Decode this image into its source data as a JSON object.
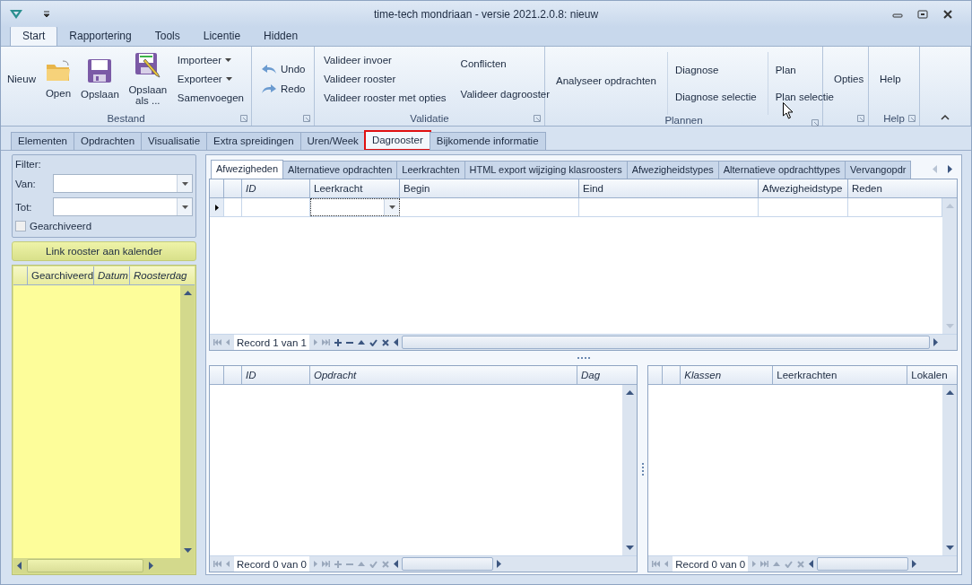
{
  "window": {
    "title": "time-tech mondriaan - versie 2021.2.0.8: nieuw"
  },
  "ribbon_tabs": [
    {
      "label": "Start",
      "selected": true
    },
    {
      "label": "Rapportering",
      "selected": false
    },
    {
      "label": "Tools",
      "selected": false
    },
    {
      "label": "Licentie",
      "selected": false
    },
    {
      "label": "Hidden",
      "selected": false
    }
  ],
  "ribbon": {
    "bestand": {
      "caption": "Bestand",
      "new": "Nieuw",
      "open": "Open",
      "save": "Opslaan",
      "save_as": "Opslaan als ...",
      "menu": [
        {
          "label": "Importeer",
          "dropdown": true
        },
        {
          "label": "Exporteer",
          "dropdown": true
        },
        {
          "label": "Samenvoegen",
          "dropdown": false
        }
      ]
    },
    "history": {
      "undo": "Undo",
      "redo": "Redo"
    },
    "validatie": {
      "caption": "Validatie",
      "column_1": [
        "Valideer invoer",
        "Valideer rooster",
        "Valideer rooster met opties"
      ],
      "column_2": [
        "Conflicten",
        "Valideer dagrooster"
      ]
    },
    "plannen": {
      "caption": "Plannen",
      "analyse": "Analyseer opdrachten",
      "column_1": [
        "Diagnose",
        "Diagnose selectie"
      ],
      "column_2": [
        "Plan",
        "Plan selectie"
      ]
    },
    "opties": {
      "label": "Opties"
    },
    "help": {
      "caption": "Help",
      "label": "Help"
    }
  },
  "main_tabs": [
    {
      "label": "Elementen",
      "selected": false,
      "highlighted": false
    },
    {
      "label": "Opdrachten",
      "selected": false,
      "highlighted": false
    },
    {
      "label": "Visualisatie",
      "selected": false,
      "highlighted": false
    },
    {
      "label": "Extra spreidingen",
      "selected": false,
      "highlighted": false
    },
    {
      "label": "Uren/Week",
      "selected": false,
      "highlighted": false
    },
    {
      "label": "Dagrooster",
      "selected": true,
      "highlighted": true
    },
    {
      "label": "Bijkomende informatie",
      "selected": false,
      "highlighted": false
    }
  ],
  "filter": {
    "title": "Filter:",
    "fields": [
      {
        "label": "Van:"
      },
      {
        "label": "Tot:"
      }
    ],
    "archived": {
      "label": "Gearchiveerd",
      "checked": false
    }
  },
  "link_button": "Link rooster aan kalender",
  "left_grid": {
    "columns": [
      {
        "label": "Gearchiveerd",
        "italic": false
      },
      {
        "label": "Datum",
        "italic": true
      },
      {
        "label": "Roosterdag",
        "italic": true
      }
    ]
  },
  "sub_tabs": [
    {
      "label": "Afwezigheden",
      "selected": true
    },
    {
      "label": "Alternatieve opdrachten",
      "selected": false
    },
    {
      "label": "Leerkrachten",
      "selected": false
    },
    {
      "label": "HTML export wijziging klasroosters",
      "selected": false
    },
    {
      "label": "Afwezigheidstypes",
      "selected": false
    },
    {
      "label": "Alternatieve opdrachttypes",
      "selected": false
    },
    {
      "label": "Vervangopdr",
      "selected": false
    }
  ],
  "top_grid": {
    "columns": [
      {
        "label": "ID",
        "italic": true
      },
      {
        "label": "Leerkracht",
        "italic": false
      },
      {
        "label": "Begin",
        "italic": false
      },
      {
        "label": "Eind",
        "italic": false
      },
      {
        "label": "Afwezigheidstype",
        "italic": false
      },
      {
        "label": "Reden",
        "italic": false
      }
    ],
    "navigator": {
      "text": "Record 1 van 1",
      "add_remove": true
    }
  },
  "bottom_grids": [
    {
      "columns": [
        {
          "label": "ID",
          "italic": true
        },
        {
          "label": "Opdracht",
          "italic": true
        },
        {
          "label": "Dag",
          "italic": true
        }
      ],
      "navigator": {
        "text": "Record 0 van 0",
        "add_remove": true
      }
    },
    {
      "columns": [
        {
          "label": "Klassen",
          "italic": true
        },
        {
          "label": "Leerkrachten",
          "italic": false
        },
        {
          "label": "Lokalen",
          "italic": false
        }
      ],
      "navigator": {
        "text": "Record 0 van 0",
        "add_remove": false
      }
    }
  ]
}
